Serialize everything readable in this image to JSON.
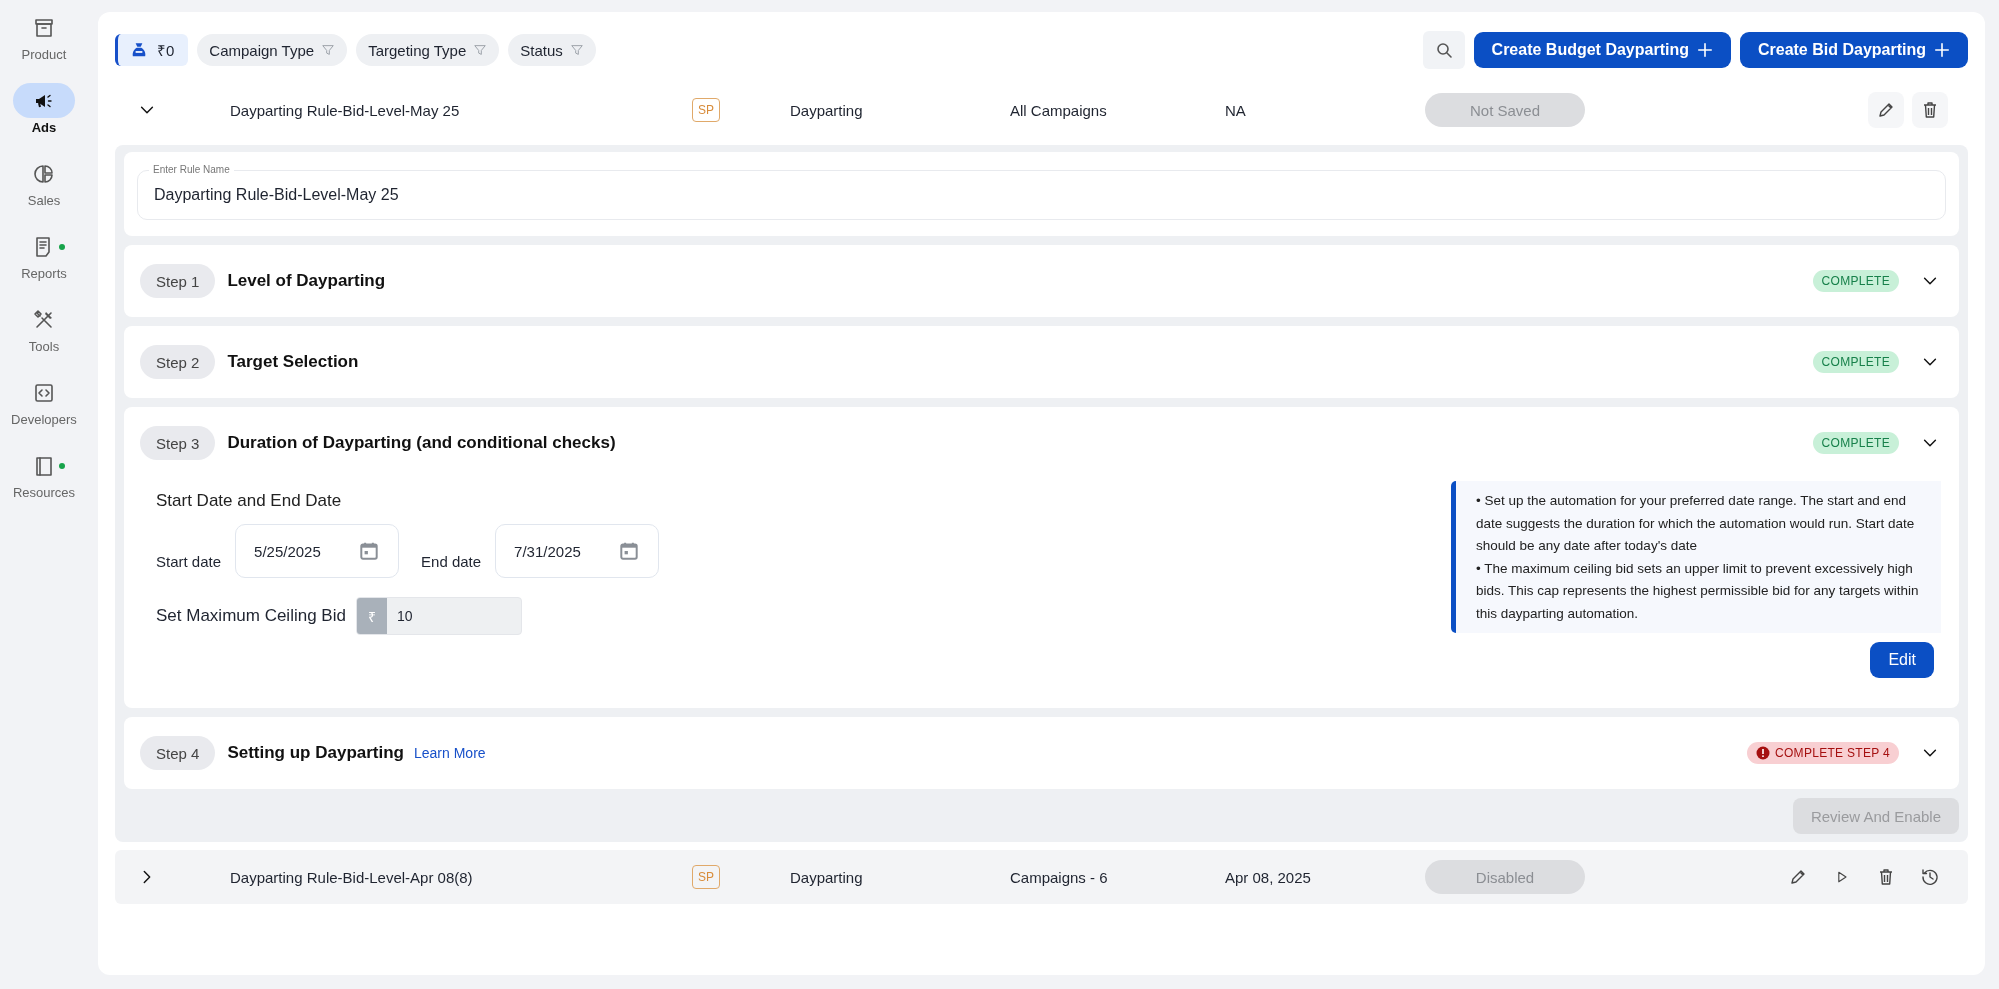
{
  "sidebar": {
    "items": [
      {
        "label": "Product",
        "selected": false,
        "notification_dot": false
      },
      {
        "label": "Ads",
        "selected": true,
        "notification_dot": false
      },
      {
        "label": "Sales",
        "selected": false,
        "notification_dot": false
      },
      {
        "label": "Reports",
        "selected": false,
        "notification_dot": true
      },
      {
        "label": "Tools",
        "selected": false,
        "notification_dot": false
      },
      {
        "label": "Developers",
        "selected": false,
        "notification_dot": false
      },
      {
        "label": "Resources",
        "selected": false,
        "notification_dot": true
      }
    ]
  },
  "toolbar": {
    "budget": "₹0",
    "filters": [
      "Campaign Type",
      "Targeting Type",
      "Status"
    ],
    "buttons": [
      "Create Budget Dayparting",
      "Create Bid Dayparting"
    ]
  },
  "rules": [
    {
      "expanded": true,
      "name": "Dayparting Rule-Bid-Level-May 25",
      "ad_type": "SP",
      "type": "Dayparting",
      "campaigns": "All Campaigns",
      "date": "NA",
      "status": "Not Saved",
      "actions": [
        {
          "kind": "edit"
        },
        {
          "kind": "delete"
        }
      ]
    },
    {
      "expanded": false,
      "name": "Dayparting Rule-Bid-Level-Apr 08(8)",
      "ad_type": "SP",
      "type": "Dayparting",
      "campaigns": "Campaigns - 6",
      "date": "Apr 08, 2025",
      "status": "Disabled",
      "actions": [
        {
          "kind": "edit"
        },
        {
          "kind": "play"
        },
        {
          "kind": "delete"
        },
        {
          "kind": "history"
        }
      ]
    }
  ],
  "editor": {
    "rule_name_label": "Enter Rule Name",
    "rule_name": "Dayparting Rule-Bid-Level-May 25",
    "steps": [
      {
        "step": "Step 1",
        "title": "Level of Dayparting",
        "status": "COMPLETE",
        "complete": true
      },
      {
        "step": "Step 2",
        "title": "Target Selection",
        "status": "COMPLETE",
        "complete": true
      },
      {
        "step": "Step 3",
        "title": "Duration of Dayparting (and conditional checks)",
        "status": "COMPLETE",
        "complete": true,
        "details": {
          "heading": "Start Date and End Date",
          "start_label": "Start date",
          "start_value": "5/25/2025",
          "end_label": "End date",
          "end_value": "7/31/2025",
          "ceiling_label": "Set Maximum Ceiling Bid",
          "currency": "₹",
          "ceiling_value": "10",
          "info": [
            "• Set up the automation for your preferred date range. The start and end date suggests the duration for which the automation would run. Start date should be any date after today's date",
            "• The maximum ceiling bid sets an upper limit to prevent excessively high bids. This cap represents the highest permissible bid for any targets within this dayparting automation."
          ],
          "edit_button": "Edit"
        }
      },
      {
        "step": "Step 4",
        "title": "Setting up Dayparting",
        "link": "Learn More",
        "status": "COMPLETE STEP 4",
        "complete": false
      }
    ],
    "review_button": {
      "label": "Review And Enable",
      "disabled": true
    }
  }
}
